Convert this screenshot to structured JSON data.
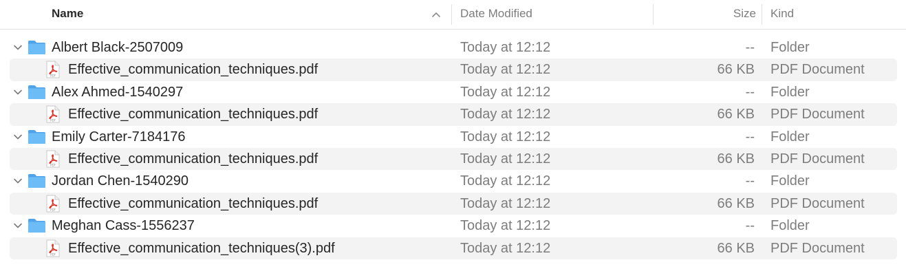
{
  "header": {
    "name": "Name",
    "date_modified": "Date Modified",
    "size": "Size",
    "kind": "Kind"
  },
  "rows": [
    {
      "type": "folder",
      "name": "Albert Black-2507009",
      "date": "Today at 12:12",
      "size": "--",
      "kind": "Folder"
    },
    {
      "type": "file",
      "name": "Effective_communication_techniques.pdf",
      "date": "Today at 12:12",
      "size": "66 KB",
      "kind": "PDF Document"
    },
    {
      "type": "folder",
      "name": "Alex Ahmed-1540297",
      "date": "Today at 12:12",
      "size": "--",
      "kind": "Folder"
    },
    {
      "type": "file",
      "name": "Effective_communication_techniques.pdf",
      "date": "Today at 12:12",
      "size": "66 KB",
      "kind": "PDF Document"
    },
    {
      "type": "folder",
      "name": "Emily Carter-7184176",
      "date": "Today at 12:12",
      "size": "--",
      "kind": "Folder"
    },
    {
      "type": "file",
      "name": "Effective_communication_techniques.pdf",
      "date": "Today at 12:12",
      "size": "66 KB",
      "kind": "PDF Document"
    },
    {
      "type": "folder",
      "name": "Jordan Chen-1540290",
      "date": "Today at 12:12",
      "size": "--",
      "kind": "Folder"
    },
    {
      "type": "file",
      "name": "Effective_communication_techniques.pdf",
      "date": "Today at 12:12",
      "size": "66 KB",
      "kind": "PDF Document"
    },
    {
      "type": "folder",
      "name": "Meghan Cass-1556237",
      "date": "Today at 12:12",
      "size": "--",
      "kind": "Folder"
    },
    {
      "type": "file",
      "name": "Effective_communication_techniques(3).pdf",
      "date": "Today at 12:12",
      "size": "66 KB",
      "kind": "PDF Document"
    }
  ],
  "icons": {
    "folder": "folder-icon",
    "file": "pdf-file-icon",
    "disclosure": "chevron-down-icon",
    "sort": "sort-ascending-icon"
  },
  "colors": {
    "folder_blue": "#5aaef2",
    "pdf_red": "#e3261c",
    "stripe": "#f3f3f3"
  }
}
